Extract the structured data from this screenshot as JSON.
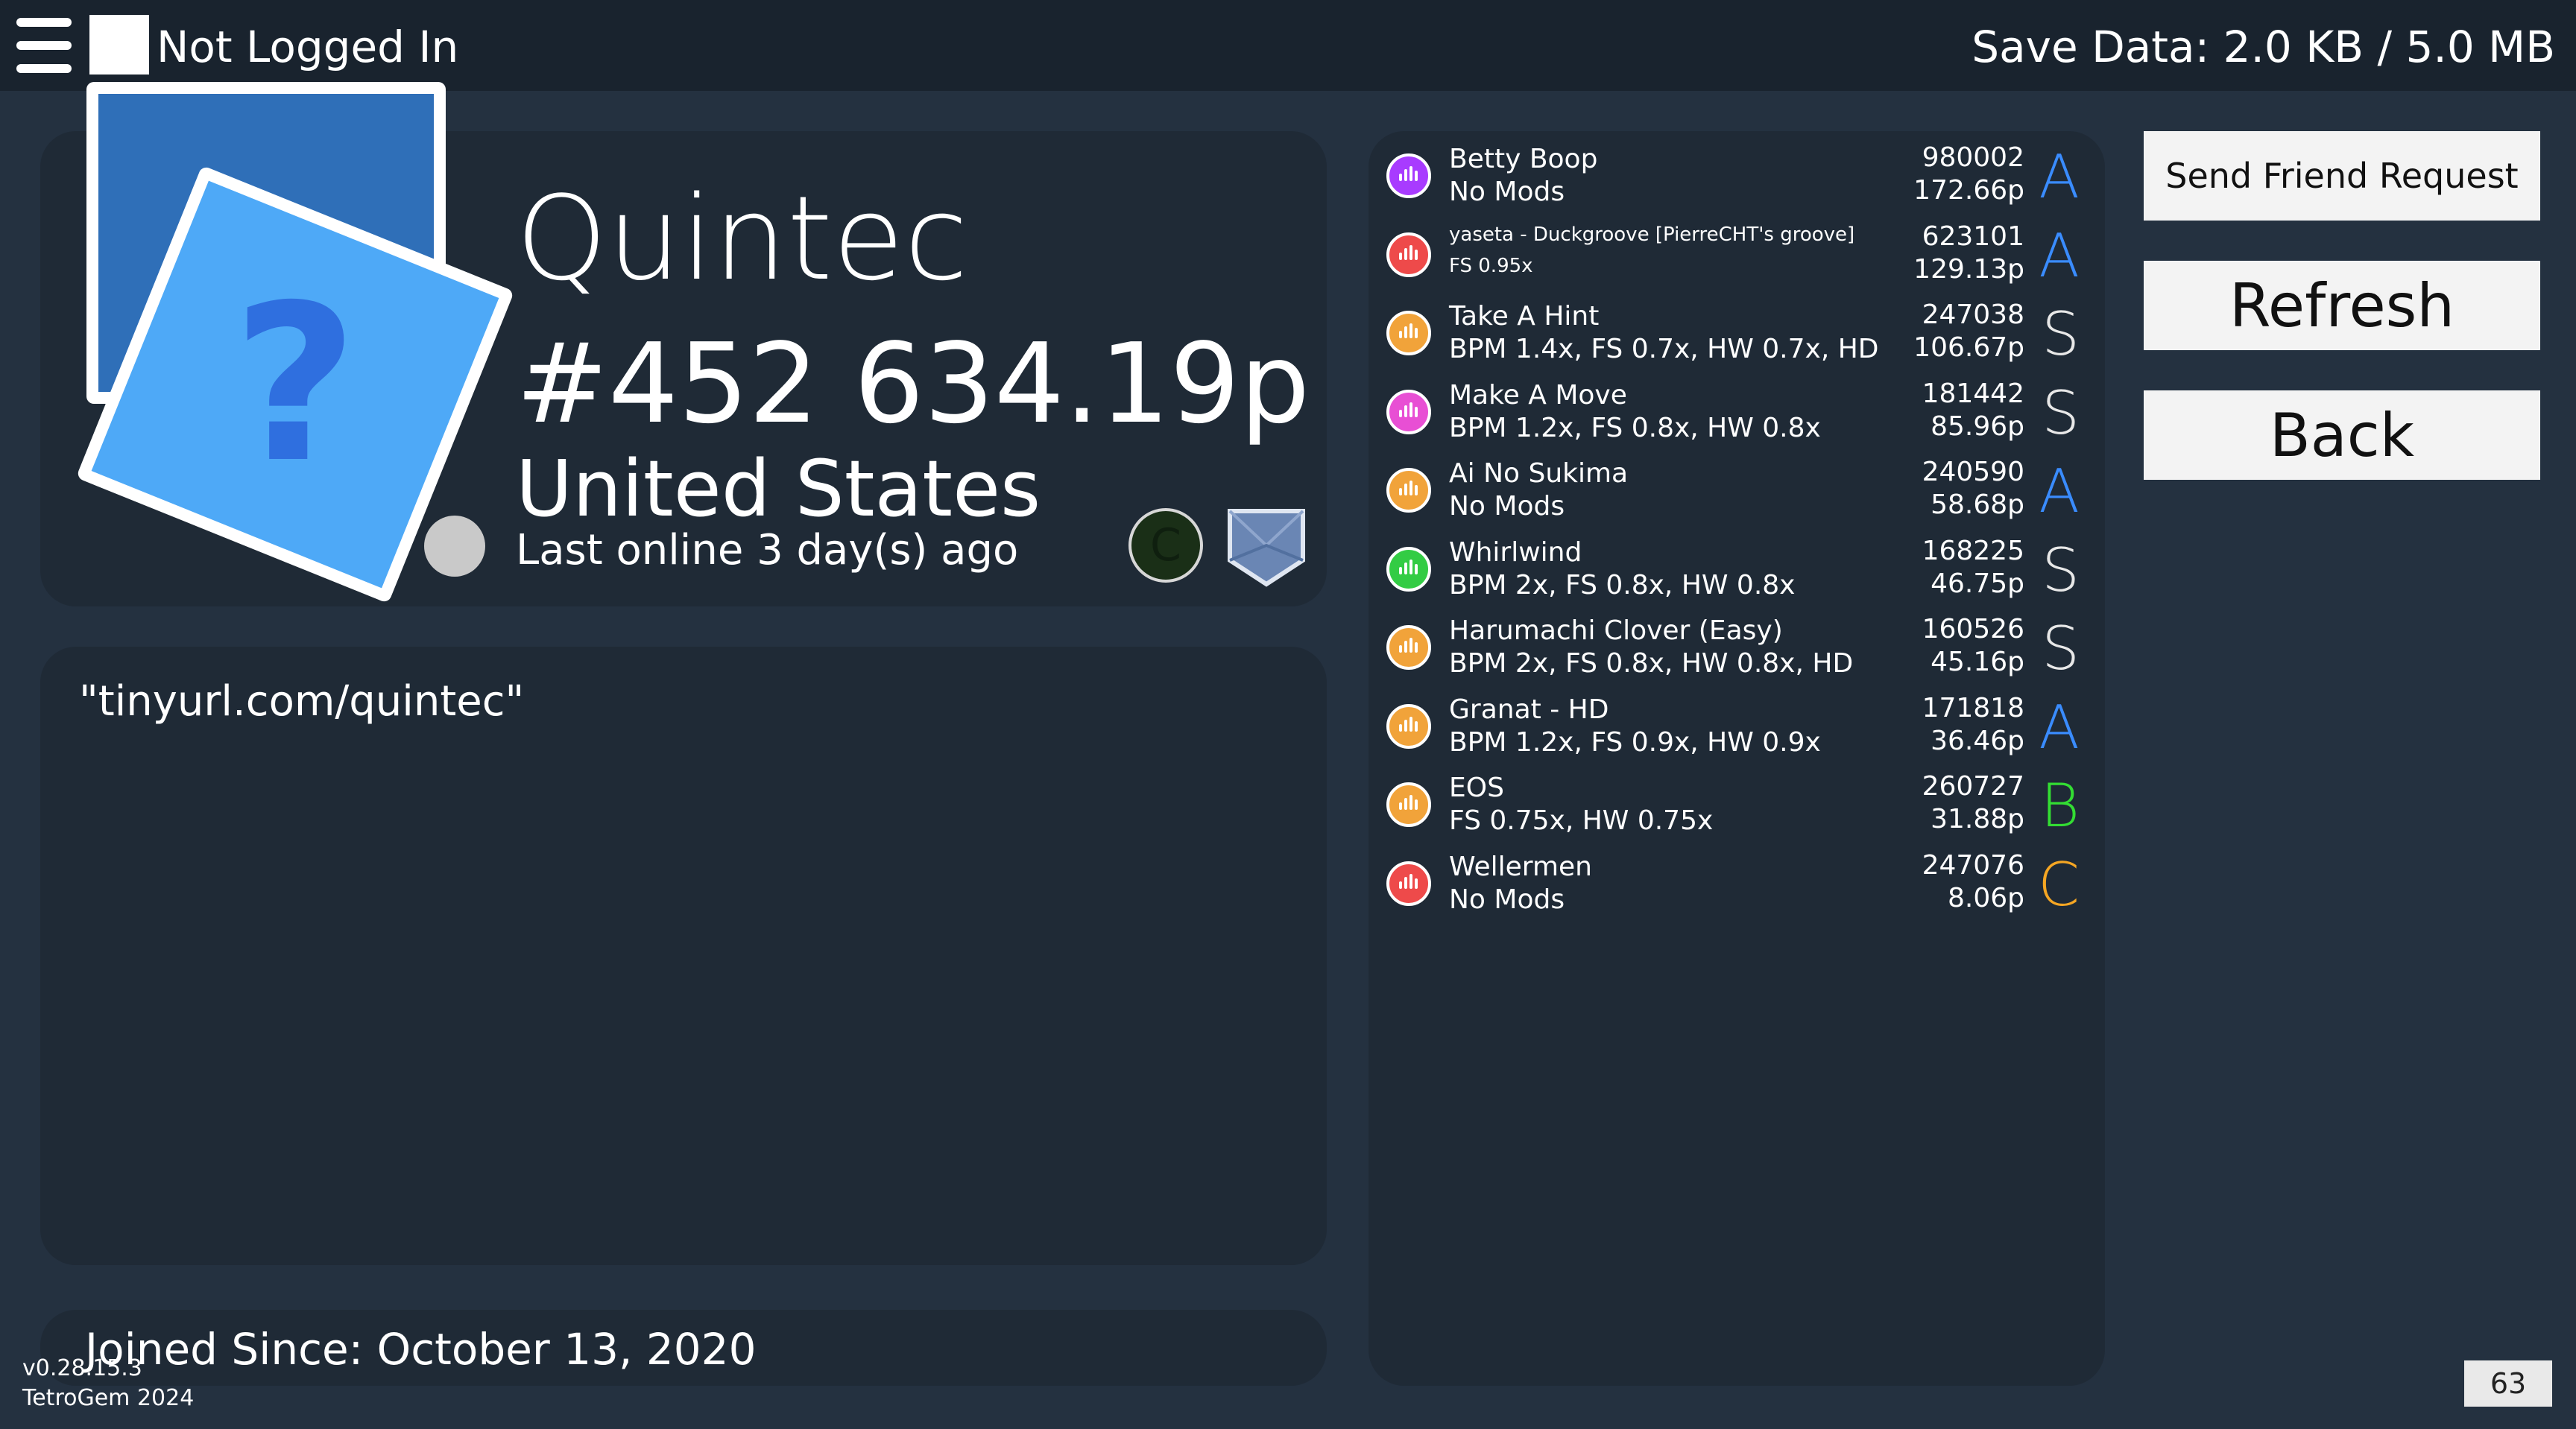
{
  "topbar": {
    "login_status": "Not Logged In",
    "save_data": "Save Data: 2.0 KB / 5.0 MB",
    "menu_icon": "hamburger-menu-icon"
  },
  "profile": {
    "username": "Quintec",
    "rank_pp": "#452 634.19p",
    "country": "United States",
    "last_online": "Last online 3 day(s) ago",
    "avatar_icon": "question-mark-avatar-icon",
    "status": "offline",
    "badges": [
      {
        "name": "c-badge-icon",
        "text": "C"
      },
      {
        "name": "shield-badge-icon"
      }
    ]
  },
  "bio": "\"tinyurl.com/quintec\"",
  "joined": "Joined Since: October 13, 2020",
  "scores": [
    {
      "song": "Betty Boop",
      "mods": "No Mods",
      "score": "980002",
      "pp": "172.66p",
      "grade": "A",
      "grade_color": "#3a8cff",
      "icon_color": "#a83bff"
    },
    {
      "song": "yaseta - Duckgroove [PierreCHT's groove]",
      "mods": "FS 0.95x",
      "score": "623101",
      "pp": "129.13p",
      "grade": "A",
      "grade_color": "#3a8cff",
      "icon_color": "#ee4a4a"
    },
    {
      "song": "Take A Hint",
      "mods": "BPM 1.4x, FS 0.7x, HW 0.7x, HD",
      "score": "247038",
      "pp": "106.67p",
      "grade": "S",
      "grade_color": "#e8e8e8",
      "icon_color": "#f1a33a"
    },
    {
      "song": "Make A Move",
      "mods": "BPM 1.2x, FS 0.8x, HW 0.8x",
      "score": "181442",
      "pp": "85.96p",
      "grade": "S",
      "grade_color": "#e8e8e8",
      "icon_color": "#e84fd4"
    },
    {
      "song": "Ai No Sukima",
      "mods": "No Mods",
      "score": "240590",
      "pp": "58.68p",
      "grade": "A",
      "grade_color": "#3a8cff",
      "icon_color": "#f1a33a"
    },
    {
      "song": "Whirlwind",
      "mods": "BPM 2x, FS 0.8x, HW 0.8x",
      "score": "168225",
      "pp": "46.75p",
      "grade": "S",
      "grade_color": "#e8e8e8",
      "icon_color": "#33cc44"
    },
    {
      "song": "Harumachi Clover (Easy)",
      "mods": "BPM 2x, FS 0.8x, HW 0.8x, HD",
      "score": "160526",
      "pp": "45.16p",
      "grade": "S",
      "grade_color": "#e8e8e8",
      "icon_color": "#f1a33a"
    },
    {
      "song": "Granat - HD",
      "mods": "BPM 1.2x, FS 0.9x, HW 0.9x",
      "score": "171818",
      "pp": "36.46p",
      "grade": "A",
      "grade_color": "#3a8cff",
      "icon_color": "#f1a33a"
    },
    {
      "song": "EOS",
      "mods": "FS 0.75x, HW 0.75x",
      "score": "260727",
      "pp": "31.88p",
      "grade": "B",
      "grade_color": "#33dd33",
      "icon_color": "#f1a33a"
    },
    {
      "song": "Wellermen",
      "mods": "No Mods",
      "score": "247076",
      "pp": "8.06p",
      "grade": "C",
      "grade_color": "#f5a623",
      "icon_color": "#ee4a4a"
    }
  ],
  "buttons": {
    "friend": "Send Friend Request",
    "refresh": "Refresh",
    "back": "Back"
  },
  "footer": {
    "version": "v0.28.15.3",
    "copyright": "TetroGem 2024",
    "fps": "63"
  }
}
